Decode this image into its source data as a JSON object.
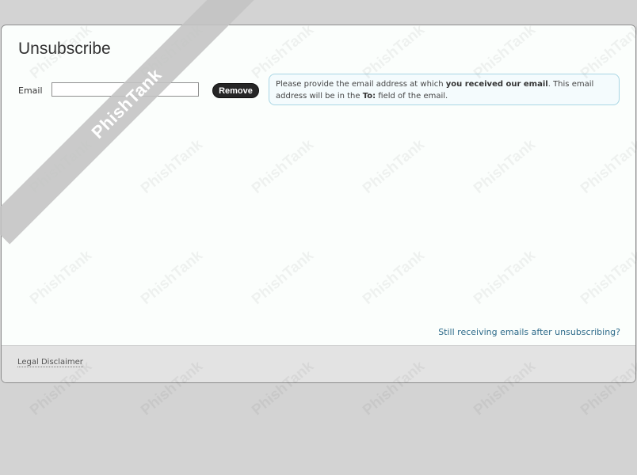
{
  "page": {
    "title": "Unsubscribe"
  },
  "form": {
    "email_label": "Email",
    "email_value": "",
    "remove_button": "Remove"
  },
  "info": {
    "part1": "Please provide the email address at which ",
    "bold1": "you received our email",
    "part2": ". This email address will be in the ",
    "bold2": "To:",
    "part3": " field of the email."
  },
  "links": {
    "still_receiving": "Still receiving emails after unsubscribing?",
    "legal": "Legal Disclaimer"
  },
  "watermark": {
    "text": "PhishTank",
    "ribbon_text": "PhishTank"
  }
}
